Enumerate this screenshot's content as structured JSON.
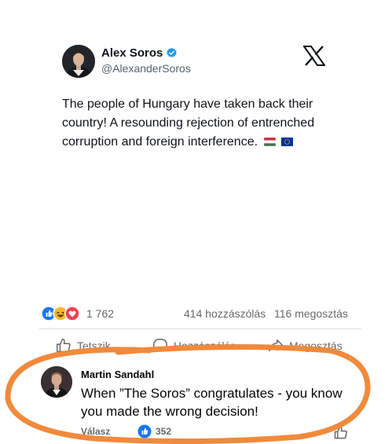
{
  "tweet": {
    "author_name": "Alex Soros",
    "handle": "@AlexanderSoros",
    "text": "The people of Hungary have taken back their country! A resounding rejection of entrenched corruption and foreign interference.",
    "flags": [
      "hungary-flag",
      "eu-flag"
    ],
    "verified_color": "#1d9bf0",
    "brand_icon": "x-logo-icon"
  },
  "post_stats": {
    "reaction_icons": [
      "like-reaction-icon",
      "haha-reaction-icon",
      "love-reaction-icon"
    ],
    "reaction_count": "1 762",
    "comments_label": "414 hozzászólás",
    "shares_label": "116 megosztás"
  },
  "actions": {
    "like_label": "Tetszik",
    "comment_label": "Hozzászólás",
    "share_label": "Megosztás"
  },
  "comment": {
    "author": "Martin Sandahl",
    "text": "When ”The Soros” congratulates - you know you made the wrong decision!",
    "reply_label": "Válasz",
    "like_count": "352"
  },
  "colors": {
    "highlight": "#f08a3c",
    "fb_blue": "#1877f2",
    "secondary_text": "#65676b"
  }
}
